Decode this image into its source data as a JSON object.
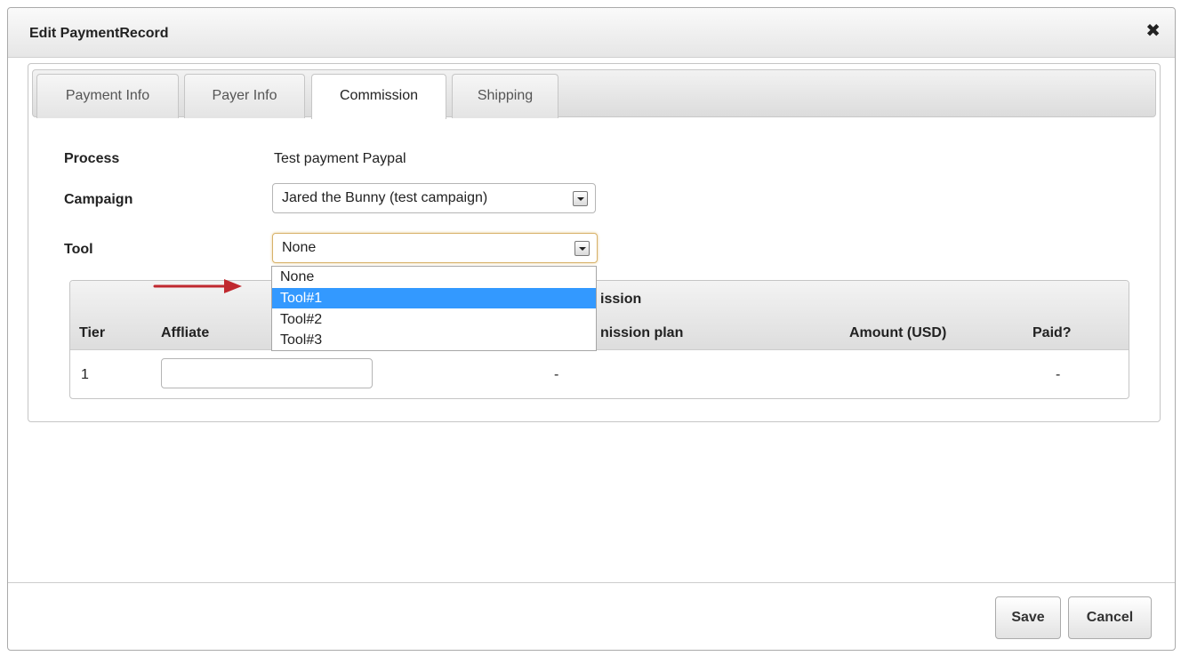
{
  "dialog": {
    "title": "Edit PaymentRecord",
    "close_glyph": "✖"
  },
  "tabs": [
    {
      "label": "Payment Info",
      "active": false
    },
    {
      "label": "Payer Info",
      "active": false
    },
    {
      "label": "Commission",
      "active": true
    },
    {
      "label": "Shipping",
      "active": false
    }
  ],
  "form": {
    "process_label": "Process",
    "process_value": "Test payment Paypal",
    "campaign_label": "Campaign",
    "campaign_value": "Jared the Bunny (test campaign)",
    "tool_label": "Tool",
    "tool_value": "None",
    "tool_options": [
      "None",
      "Tool#1",
      "Tool#2",
      "Tool#3"
    ],
    "tool_highlighted_option": "Tool#1"
  },
  "grid": {
    "group_header": "Commission",
    "group_header_visible": "ission",
    "columns": [
      "Tier",
      "Affliate",
      "Commission plan",
      "Amount (USD)",
      "Paid?"
    ],
    "column_commission_plan_visible": "nission plan",
    "rows": [
      {
        "tier": "1",
        "affiliate": "",
        "commission_plan": "-",
        "amount": "",
        "paid": "-"
      }
    ]
  },
  "buttons": {
    "save": "Save",
    "cancel": "Cancel"
  },
  "colors": {
    "selection": "#3399ff",
    "annotation_arrow": "#c0282e",
    "focus_border": "#d8b26a"
  },
  "icons": [
    "close-icon",
    "dropdown-arrow-icon",
    "annotation-arrow-icon"
  ]
}
